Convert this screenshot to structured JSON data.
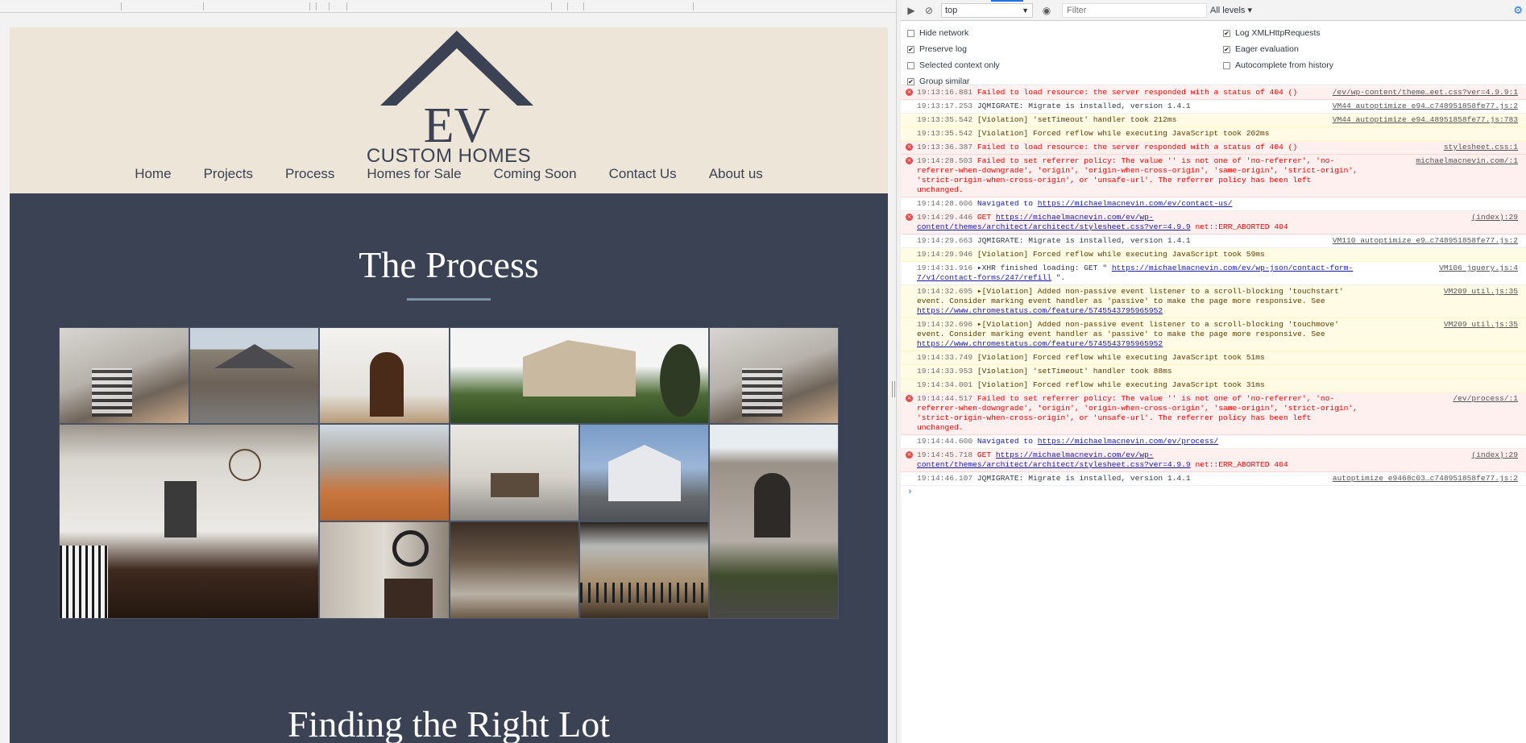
{
  "site": {
    "logo_monogram": "EV",
    "logo_text": "CUSTOM HOMES",
    "nav": [
      "Home",
      "Projects",
      "Process",
      "Homes for Sale",
      "Coming Soon",
      "Contact Us",
      "About us"
    ],
    "section_title": "The Process",
    "next_section_title": "Finding the Right Lot",
    "colors": {
      "header_bg": "#ece5d8",
      "body_bg": "#3a4253",
      "accent": "#7a93a6"
    }
  },
  "devtools": {
    "context": "top",
    "filter_placeholder": "Filter",
    "levels": "All levels ▾",
    "options": [
      {
        "label": "Hide network",
        "checked": false
      },
      {
        "label": "Log XMLHttpRequests",
        "checked": true
      },
      {
        "label": "Preserve log",
        "checked": true
      },
      {
        "label": "Eager evaluation",
        "checked": true
      },
      {
        "label": "Selected context only",
        "checked": false
      },
      {
        "label": "Autocomplete from history",
        "checked": false
      },
      {
        "label": "Group similar",
        "checked": true
      }
    ],
    "messages": [
      {
        "level": "error",
        "time": "19:13:16.881",
        "text": "Failed to load resource: the server responded with a status of 404 ()",
        "source": "/ev/wp-content/theme…eet.css?ver=4.9.9:1"
      },
      {
        "level": "info",
        "time": "19:13:17.253",
        "text": "JQMIGRATE: Migrate is installed, version 1.4.1",
        "source": "VM44 autoptimize e94…c748951858fe77.js:2"
      },
      {
        "level": "warn",
        "time": "19:13:35.542",
        "text": "[Violation] 'setTimeout' handler took 212ms",
        "source": "VM44 autoptimize e94…48951858fe77.js:783"
      },
      {
        "level": "warn",
        "time": "19:13:35.542",
        "text": "[Violation] Forced reflow while executing JavaScript took 202ms",
        "source": ""
      },
      {
        "level": "error",
        "time": "19:13:36.387",
        "text": "Failed to load resource: the server responded with a status of 404 ()",
        "source": "stylesheet.css:1"
      },
      {
        "level": "error",
        "time": "19:14:28.503",
        "text": "Failed to set referrer policy: The value '' is not one of 'no-referrer', 'no-referrer-when-downgrade', 'origin', 'origin-when-cross-origin', 'same-origin', 'strict-origin', 'strict-origin-when-cross-origin', or 'unsafe-url'. The referrer policy has been left unchanged.",
        "source": "michaelmacnevin.com/:1"
      },
      {
        "level": "info",
        "time": "19:14:28.606",
        "text": "Navigated to",
        "link": "https://michaelmacnevin.com/ev/contact-us/",
        "source": ""
      },
      {
        "level": "error",
        "time": "19:14:29.446",
        "text": "GET",
        "link": "https://michaelmacnevin.com/ev/wp-content/themes/architect/architect/stylesheet.css?ver=4.9.9",
        "tail": "net::ERR_ABORTED 404",
        "source": "(index):29"
      },
      {
        "level": "info",
        "time": "19:14:29.663",
        "text": "JQMIGRATE: Migrate is installed, version 1.4.1",
        "source": "VM110 autoptimize e9…c748951858fe77.js:2"
      },
      {
        "level": "warn",
        "time": "19:14:29.946",
        "text": "[Violation] Forced reflow while executing JavaScript took 59ms",
        "source": ""
      },
      {
        "level": "info",
        "time": "19:14:31.916",
        "text": "▸XHR finished loading: GET \"",
        "link": "https://michaelmacnevin.com/ev/wp-json/contact-form-7/v1/contact-forms/247/refill",
        "tail": "\".",
        "source": "VM106 jquery.js:4"
      },
      {
        "level": "warn",
        "time": "19:14:32.695",
        "text": "▸[Violation] Added non-passive event listener to a scroll-blocking 'touchstart' event. Consider marking event handler as 'passive' to make the page more responsive. See",
        "link": "https://www.chromestatus.com/feature/5745543795965952",
        "source": "VM209 util.js:35"
      },
      {
        "level": "warn",
        "time": "19:14:32.696",
        "text": "▸[Violation] Added non-passive event listener to a scroll-blocking 'touchmove' event. Consider marking event handler as 'passive' to make the page more responsive. See",
        "link": "https://www.chromestatus.com/feature/5745543795965952",
        "source": "VM209 util.js:35"
      },
      {
        "level": "warn",
        "time": "19:14:33.749",
        "text": "[Violation] Forced reflow while executing JavaScript took 51ms",
        "source": ""
      },
      {
        "level": "warn",
        "time": "19:14:33.953",
        "text": "[Violation] 'setTimeout' handler took 88ms",
        "source": ""
      },
      {
        "level": "warn",
        "time": "19:14:34.001",
        "text": "[Violation] Forced reflow while executing JavaScript took 31ms",
        "source": ""
      },
      {
        "level": "error",
        "time": "19:14:44.517",
        "text": "Failed to set referrer policy: The value '' is not one of 'no-referrer', 'no-referrer-when-downgrade', 'origin', 'origin-when-cross-origin', 'same-origin', 'strict-origin', 'strict-origin-when-cross-origin', or 'unsafe-url'. The referrer policy has been left unchanged.",
        "source": "/ev/process/:1"
      },
      {
        "level": "info",
        "time": "19:14:44.600",
        "text": "Navigated to",
        "link": "https://michaelmacnevin.com/ev/process/",
        "source": ""
      },
      {
        "level": "error",
        "time": "19:14:45.718",
        "text": "GET",
        "link": "https://michaelmacnevin.com/ev/wp-content/themes/architect/architect/stylesheet.css?ver=4.9.9",
        "tail": "net::ERR_ABORTED 404",
        "source": "(index):29"
      },
      {
        "level": "info",
        "time": "19:14:46.107",
        "text": "JQMIGRATE: Migrate is installed, version 1.4.1",
        "source": "autoptimize e9468c03…c748951858fe77.js:2"
      }
    ],
    "prompt": "›"
  }
}
